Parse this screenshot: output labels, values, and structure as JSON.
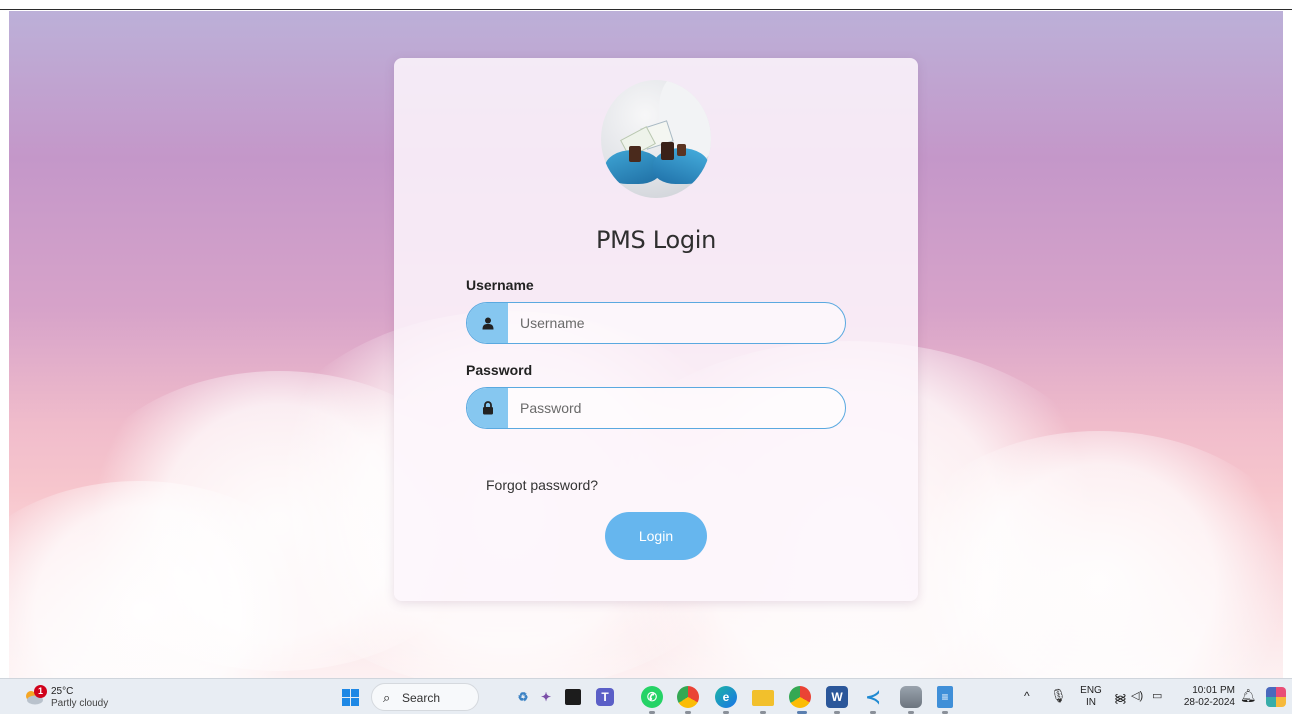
{
  "login_card": {
    "title": "PMS Login",
    "username_label": "Username",
    "username_placeholder": "Username",
    "username_value": "",
    "password_label": "Password",
    "password_placeholder": "Password",
    "password_value": "",
    "forgot_password_text": "Forgot password?",
    "login_button_label": "Login",
    "accent_color": "#66b6ee"
  },
  "taskbar": {
    "weather": {
      "temperature": "25°C",
      "condition": "Partly cloudy",
      "badge_count": "1"
    },
    "search_label": "Search",
    "pinned_apps": [
      {
        "icon": "copilot-like-app-icon"
      },
      {
        "icon": "satellite-app-icon"
      },
      {
        "icon": "task-view-icon"
      },
      {
        "icon": "teams-icon"
      },
      {
        "icon": "whatsapp-icon"
      },
      {
        "icon": "chrome-icon"
      },
      {
        "icon": "edge-icon"
      },
      {
        "icon": "file-explorer-icon"
      },
      {
        "icon": "chrome-profile-icon"
      },
      {
        "icon": "word-icon"
      },
      {
        "icon": "vscode-icon"
      },
      {
        "icon": "database-icon"
      },
      {
        "icon": "notepad-icon"
      }
    ],
    "tray": {
      "language_line1": "ENG",
      "language_line2": "IN",
      "time": "10:01 PM",
      "date": "28-02-2024"
    }
  }
}
